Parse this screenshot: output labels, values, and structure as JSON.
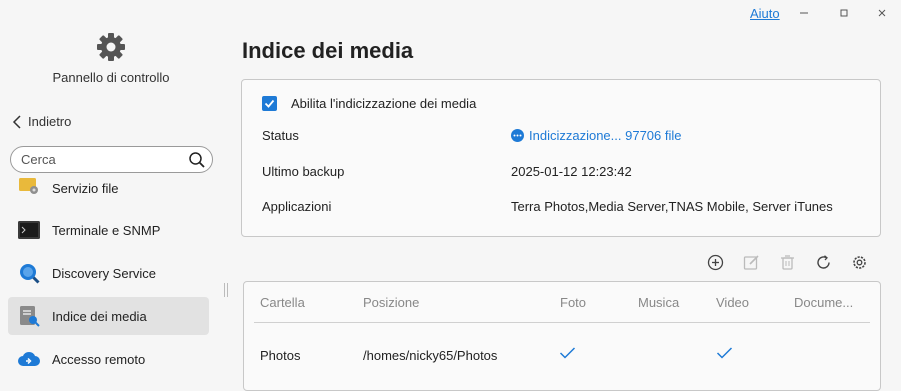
{
  "window": {
    "help_label": "Aiuto"
  },
  "sidebar": {
    "title": "Pannello di controllo",
    "back_label": "Indietro",
    "search_placeholder": "Cerca",
    "items": [
      {
        "label": "Servizio file",
        "icon": "folder-share-icon"
      },
      {
        "label": "Terminale e SNMP",
        "icon": "terminal-icon"
      },
      {
        "label": "Discovery Service",
        "icon": "magnifier-icon"
      },
      {
        "label": "Indice dei media",
        "icon": "media-index-icon",
        "active": true
      },
      {
        "label": "Accesso remoto",
        "icon": "cloud-remote-icon"
      }
    ]
  },
  "main": {
    "title": "Indice dei media",
    "enable_label": "Abilita l'indicizzazione dei media",
    "enable_checked": true,
    "status_label": "Status",
    "status_value": "Indicizzazione... 97706 file",
    "backup_label": "Ultimo backup",
    "backup_value": "2025-01-12 12:23:42",
    "apps_label": "Applicazioni",
    "apps_value": "Terra Photos,Media Server,TNAS Mobile, Server iTunes"
  },
  "toolbar": [
    "add-icon",
    "edit-icon",
    "delete-icon",
    "refresh-icon",
    "settings-icon"
  ],
  "table": {
    "headers": [
      "Cartella",
      "Posizione",
      "Foto",
      "Musica",
      "Video",
      "Docume..."
    ],
    "rows": [
      {
        "folder": "Photos",
        "path": "/homes/nicky65/Photos",
        "photo": true,
        "music": false,
        "video": true,
        "documents": false
      }
    ]
  },
  "colors": {
    "accent": "#1e7ad6",
    "active_nav": "#e2e2e2"
  }
}
